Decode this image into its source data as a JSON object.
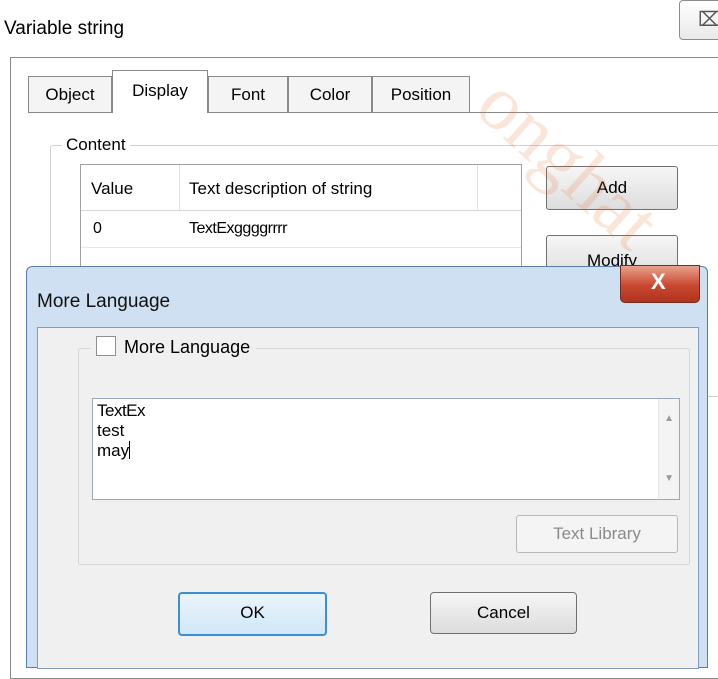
{
  "outer_window": {
    "title": "Variable string",
    "close_glyph": "⌧",
    "tabs": [
      {
        "label": "Object"
      },
      {
        "label": "Display"
      },
      {
        "label": "Font"
      },
      {
        "label": "Color"
      },
      {
        "label": "Position"
      }
    ],
    "active_tab": "Display",
    "content_label": "Content",
    "table": {
      "columns": [
        "Value",
        "Text description of string"
      ],
      "rows": [
        {
          "value": "0",
          "text": "TextExggggrrrr"
        }
      ]
    },
    "buttons": {
      "add": "Add",
      "modify": "Modify"
    }
  },
  "dialog": {
    "title": "More Language",
    "close_glyph": "X",
    "checkbox_label": "More Language",
    "checkbox_checked": false,
    "text_lines": [
      "TextEx",
      "test",
      "may"
    ],
    "text_library_button": "Text Library",
    "ok_button": "OK",
    "cancel_button": "Cancel"
  },
  "watermark": "onghat",
  "colors": {
    "dialog_frame": "#cfe0f2",
    "close_red": "#c9472f",
    "ok_border": "#3c8fd4"
  }
}
